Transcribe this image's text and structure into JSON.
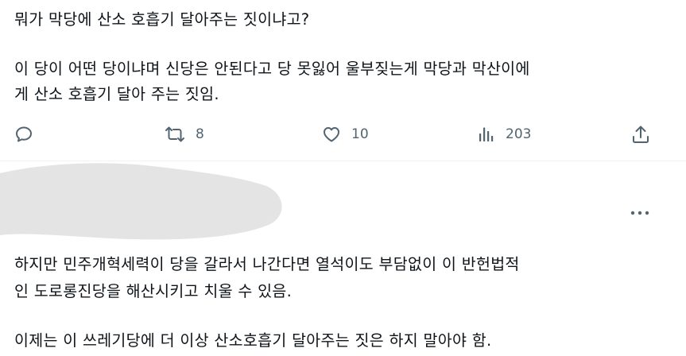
{
  "tweet1": {
    "lines": [
      "뭐가 막당에 산소 호흡기 달아주는 짓이냐고?",
      "이 당이 어떤 당이냐며 신당은 안된다고 당 못잃어 울부짖는게 막당과 막산이에",
      "게 산소 호흡기 달아 주는 짓임."
    ],
    "actions": {
      "reply_icon": "reply-icon",
      "retweet_icon": "retweet-icon",
      "retweet_count": "8",
      "like_icon": "heart-icon",
      "like_count": "10",
      "views_icon": "views-icon",
      "views_count": "203",
      "share_icon": "share-icon"
    }
  },
  "tweet2": {
    "more_icon": "more-icon",
    "lines": [
      "하지만 민주개혁세력이 당을 갈라서 나간다면 열석이도 부담없이 이 반헌법적",
      "인 도로롱진당을 해산시키고 치울 수 있음.",
      "이제는 이 쓰레기당에 더 이상 산소호흡기 달아주는 짓은 하지 말아야 함."
    ]
  },
  "colors": {
    "text": "#0f1419",
    "secondary": "#536471",
    "divider": "#eff3f4",
    "redaction": "#e3e3e3"
  }
}
